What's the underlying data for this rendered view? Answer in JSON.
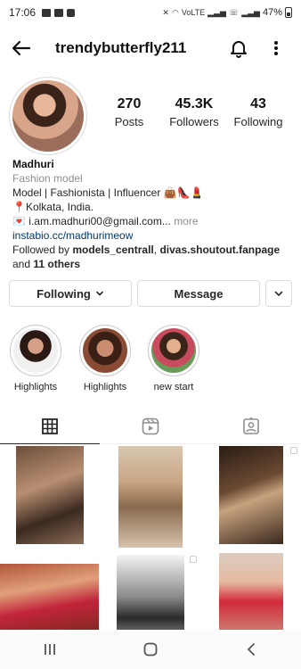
{
  "status_bar": {
    "time": "17:06",
    "network_label": "VoLTE",
    "battery": "47%"
  },
  "header": {
    "username": "trendybutterfly211",
    "back_icon": "arrow-left-icon",
    "bell_icon": "bell-icon",
    "menu_icon": "more-vertical-icon"
  },
  "stats": {
    "posts": {
      "count": "270",
      "label": "Posts"
    },
    "followers": {
      "count": "45.3K",
      "label": "Followers"
    },
    "following": {
      "count": "43",
      "label": "Following"
    }
  },
  "bio": {
    "name": "Madhuri",
    "category": "Fashion model",
    "line1": "Model | Fashionista | Influencer 👜👠💄",
    "line2": "📍Kolkata, India.",
    "line3": "💌 i.am.madhuri00@gmail.com...",
    "more": "more",
    "link": "instabio.cc/madhurimeow",
    "followed_by_prefix": "Followed by",
    "followed_by_users": "models_centrall",
    "followed_by_sep": ",",
    "followed_by_users_2": "divas.shoutout.fanpage",
    "followed_by_and": "and",
    "followed_by_others": "11 others"
  },
  "actions": {
    "following_label": "Following",
    "message_label": "Message"
  },
  "highlights": [
    {
      "label": "Highlights"
    },
    {
      "label": "Highlights"
    },
    {
      "label": "new start"
    }
  ],
  "tabs": {
    "grid_icon": "grid-icon",
    "reels_icon": "reels-icon",
    "tagged_icon": "tagged-icon",
    "active": "grid"
  },
  "colors": {
    "link": "#00376b",
    "muted": "#8e8e8e",
    "border": "#dbdbdb"
  }
}
